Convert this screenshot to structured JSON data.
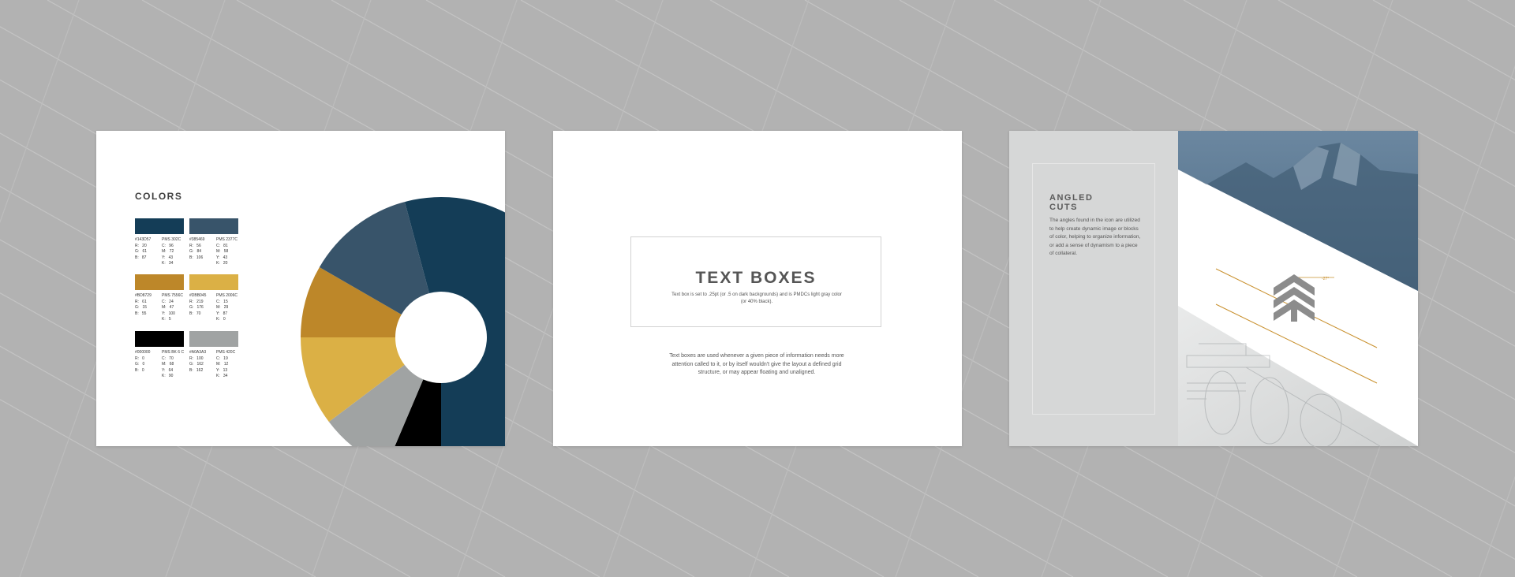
{
  "slides": {
    "colors": {
      "title": "COLORS",
      "swatches": [
        {
          "color": "#143D57",
          "hex_label": "#143D57",
          "pms_label": "PMS 302C",
          "rgb": "R:   20\nG:   61\nB:   87",
          "cmyk": "C:   96\nM:   72\nY:   43\nK:   34"
        },
        {
          "color": "#38546A",
          "hex_label": "#385469",
          "pms_label": "PMS 2377C",
          "rgb": "R:   56\nG:   84\nB:   106",
          "cmyk": "C:   81\nM:   58\nY:   43\nK:   20"
        },
        {
          "color": "#BD8729",
          "hex_label": "#BD8729",
          "pms_label": "PMS 7556C",
          "rgb": "R:   61\nG:   15\nB:   55",
          "cmyk": "C:   24\nM:   47\nY:   100\nK:   5"
        },
        {
          "color": "#DBB045",
          "hex_label": "#DBB045",
          "pms_label": "PMS 2006C",
          "rgb": "R:   219\nG:   176\nB:   70",
          "cmyk": "C:   15\nM:   29\nY:   87\nK:   0"
        },
        {
          "color": "#000000",
          "hex_label": "#000000",
          "pms_label": "PMS BK 6 C",
          "rgb": "R:   0\nG:   0\nB:   0",
          "cmyk": "C:   70\nM:   68\nY:   64\nK:   90"
        },
        {
          "color": "#A0A3A3",
          "hex_label": "#A0A3A3",
          "pms_label": "PMS 420C",
          "rgb": "R:   100\nG:   162\nB:   162",
          "cmyk": "C:   19\nM:   12\nY:   13\nK:   34"
        }
      ]
    },
    "text_boxes": {
      "title": "TEXT BOXES",
      "subtitle": "Text box is set to .25pt (or .5 on dark backgrounds) and is PMDCs light gray color (or 40% black).",
      "body": "Text boxes are used whenever a given piece of information needs more attention called to it, or by itself wouldn't give the layout a defined grid structure, or may appear floating and unaligned."
    },
    "angled_cuts": {
      "title": "ANGLED\nCUTS",
      "body": "The angles found in the icon are utilized to help create dynamic image or blocks of color, helping to organize information, or add a sense of dynamism to a piece of collateral.",
      "angle_label": "-27°"
    }
  },
  "colors": {
    "background": "#b2b2b2",
    "navy": "#143D57",
    "slate": "#38546A",
    "ochre": "#BD8729",
    "gold": "#DBB045",
    "gray": "#A0A3A3",
    "black": "#000000",
    "panel": "#d6d7d7",
    "accent_line": "#c9912f"
  },
  "icons": [
    "tree-chevron-icon"
  ]
}
